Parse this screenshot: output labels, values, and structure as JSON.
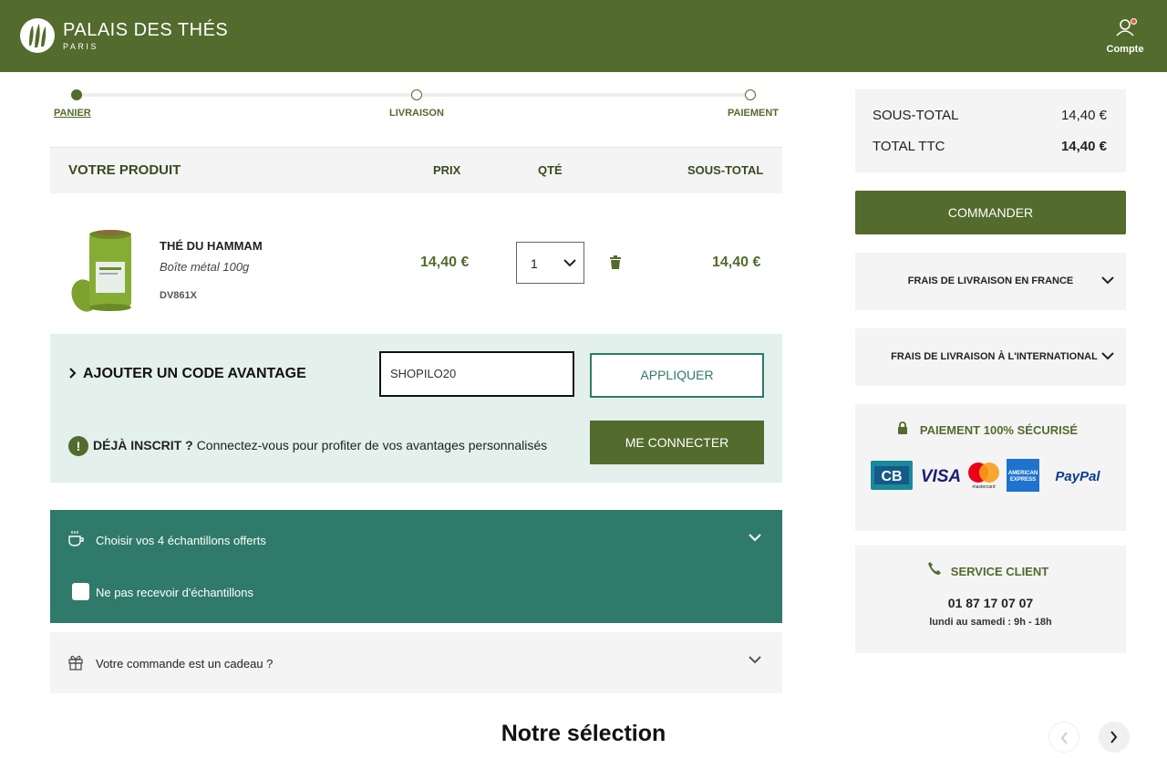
{
  "header": {
    "brand": "PALAIS DES THÉS",
    "brand_sub": "PARIS",
    "account_label": "Compte"
  },
  "steps": [
    {
      "label": "PANIER",
      "active": true
    },
    {
      "label": "LIVRAISON",
      "active": false
    },
    {
      "label": "PAIEMENT",
      "active": false
    }
  ],
  "table": {
    "col_product": "VOTRE PRODUIT",
    "col_price": "PRIX",
    "col_qty": "QTÉ",
    "col_subtotal": "SOUS-TOTAL"
  },
  "product": {
    "name": "THÉ DU HAMMAM",
    "variant": "Boîte métal 100g",
    "ref": "DV861X",
    "price": "14,40 €",
    "qty": "1",
    "subtotal": "14,40 €"
  },
  "promo": {
    "title": "AJOUTER UN CODE AVANTAGE",
    "input_value": "SHOPILO20",
    "apply_label": "APPLIQUER",
    "info_bold": "DÉJÀ INSCRIT ?",
    "info_text": "Connectez-vous pour profiter de vos avantages personnalisés",
    "login_label": "ME CONNECTER"
  },
  "samples": {
    "title": "Choisir vos 4 échantillons offerts",
    "no_samples_label": "Ne pas recevoir d'échantillons"
  },
  "gift": {
    "title": "Votre commande est un cadeau ?"
  },
  "selection_title": "Notre sélection",
  "totals": {
    "subtotal_label": "SOUS-TOTAL",
    "subtotal_value": "14,40 €",
    "total_label": "TOTAL TTC",
    "total_value": "14,40 €"
  },
  "order_label": "COMMANDER",
  "shipping": {
    "france": "FRAIS DE LIVRAISON EN FRANCE",
    "international": "FRAIS DE LIVRAISON À L'INTERNATIONAL"
  },
  "secure": {
    "title": "PAIEMENT 100% SÉCURISÉ",
    "cards": [
      "CB",
      "VISA",
      "mastercard",
      "AMERICAN EXPRESS",
      "PayPal"
    ]
  },
  "service": {
    "title": "SERVICE CLIENT",
    "phone": "01 87 17 07 07",
    "hours": "lundi au samedi : 9h - 18h"
  },
  "colors": {
    "brand_green": "#536b2d",
    "teal": "#2f7a6a",
    "promo_bg": "#e3f0ec",
    "panel_bg": "#f4f4f4"
  }
}
